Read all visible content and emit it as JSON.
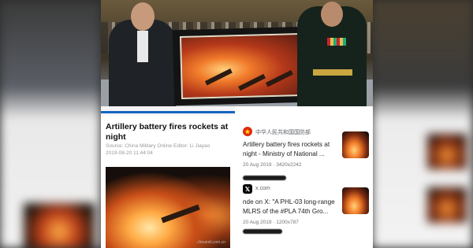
{
  "article": {
    "title": "Artillery battery fires rockets at night",
    "meta_line": "Source: China Military Online  Editor: Li Jiayao",
    "date_line": "2019-08-20 11:44:04",
    "watermark": "chinamil.com.cn"
  },
  "results": [
    {
      "source": "中华人民共和国国防部",
      "favicon": "china-emblem-icon",
      "title": "Artillery battery fires rockets at night - Ministry of National ...",
      "info": "20 Aug 2019 · 3420x2242"
    },
    {
      "source": "x.com",
      "favicon": "x-logo-icon",
      "title": "nde on X: \"A PHL-03 long-range MLRS of the #PLA 74th Gro...",
      "info": "20 Aug 2019 · 1200x787"
    }
  ],
  "colors": {
    "accent_blue": "#1565c0",
    "emblem_red": "#de2910",
    "emblem_gold": "#ffde00"
  }
}
